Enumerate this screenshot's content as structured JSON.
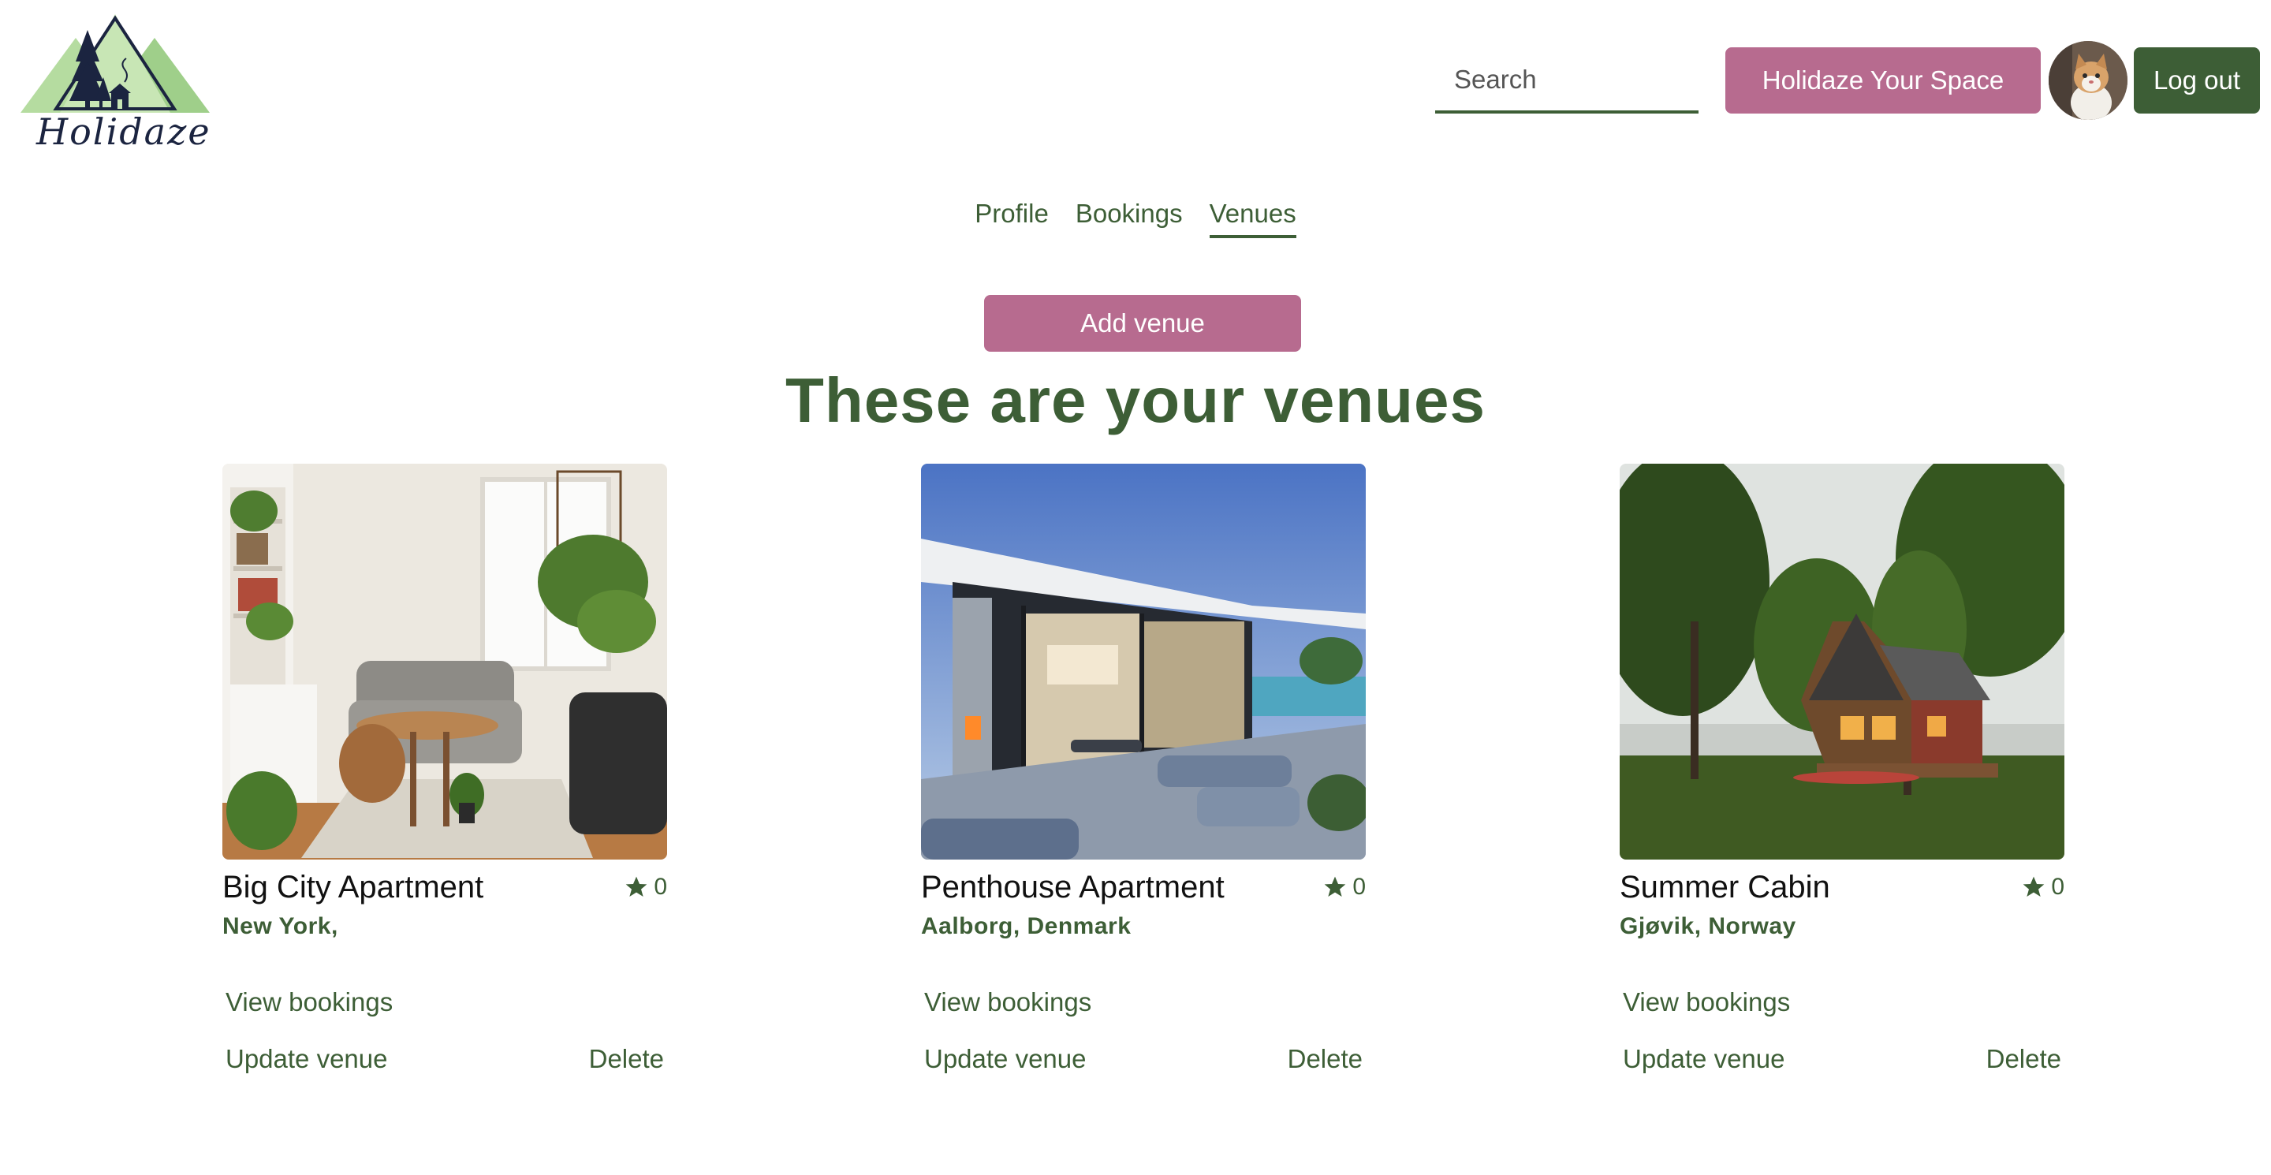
{
  "brand": {
    "name": "Holidaze"
  },
  "header": {
    "search_placeholder": "Search",
    "cta_label": "Holidaze Your Space",
    "logout_label": "Log out"
  },
  "tabs": [
    {
      "label": "Profile",
      "active": false
    },
    {
      "label": "Bookings",
      "active": false
    },
    {
      "label": "Venues",
      "active": true
    }
  ],
  "actions": {
    "add_venue_label": "Add venue"
  },
  "main": {
    "heading": "These are your venues"
  },
  "venues": [
    {
      "name": "Big City Apartment",
      "rating": "0",
      "location": "New York,",
      "view_label": "View bookings",
      "update_label": "Update venue",
      "delete_label": "Delete"
    },
    {
      "name": "Penthouse Apartment",
      "rating": "0",
      "location": "Aalborg, Denmark",
      "view_label": "View bookings",
      "update_label": "Update venue",
      "delete_label": "Delete"
    },
    {
      "name": "Summer Cabin",
      "rating": "0",
      "location": "Gjøvik, Norway",
      "view_label": "View bookings",
      "update_label": "Update venue",
      "delete_label": "Delete"
    }
  ],
  "colors": {
    "primary_green": "#3d5e36",
    "accent_pink": "#b76b8f",
    "logo_green": "#9fcf8a"
  },
  "icons": {
    "rating": "star-icon",
    "logo": "mountain-cabin-logo"
  }
}
